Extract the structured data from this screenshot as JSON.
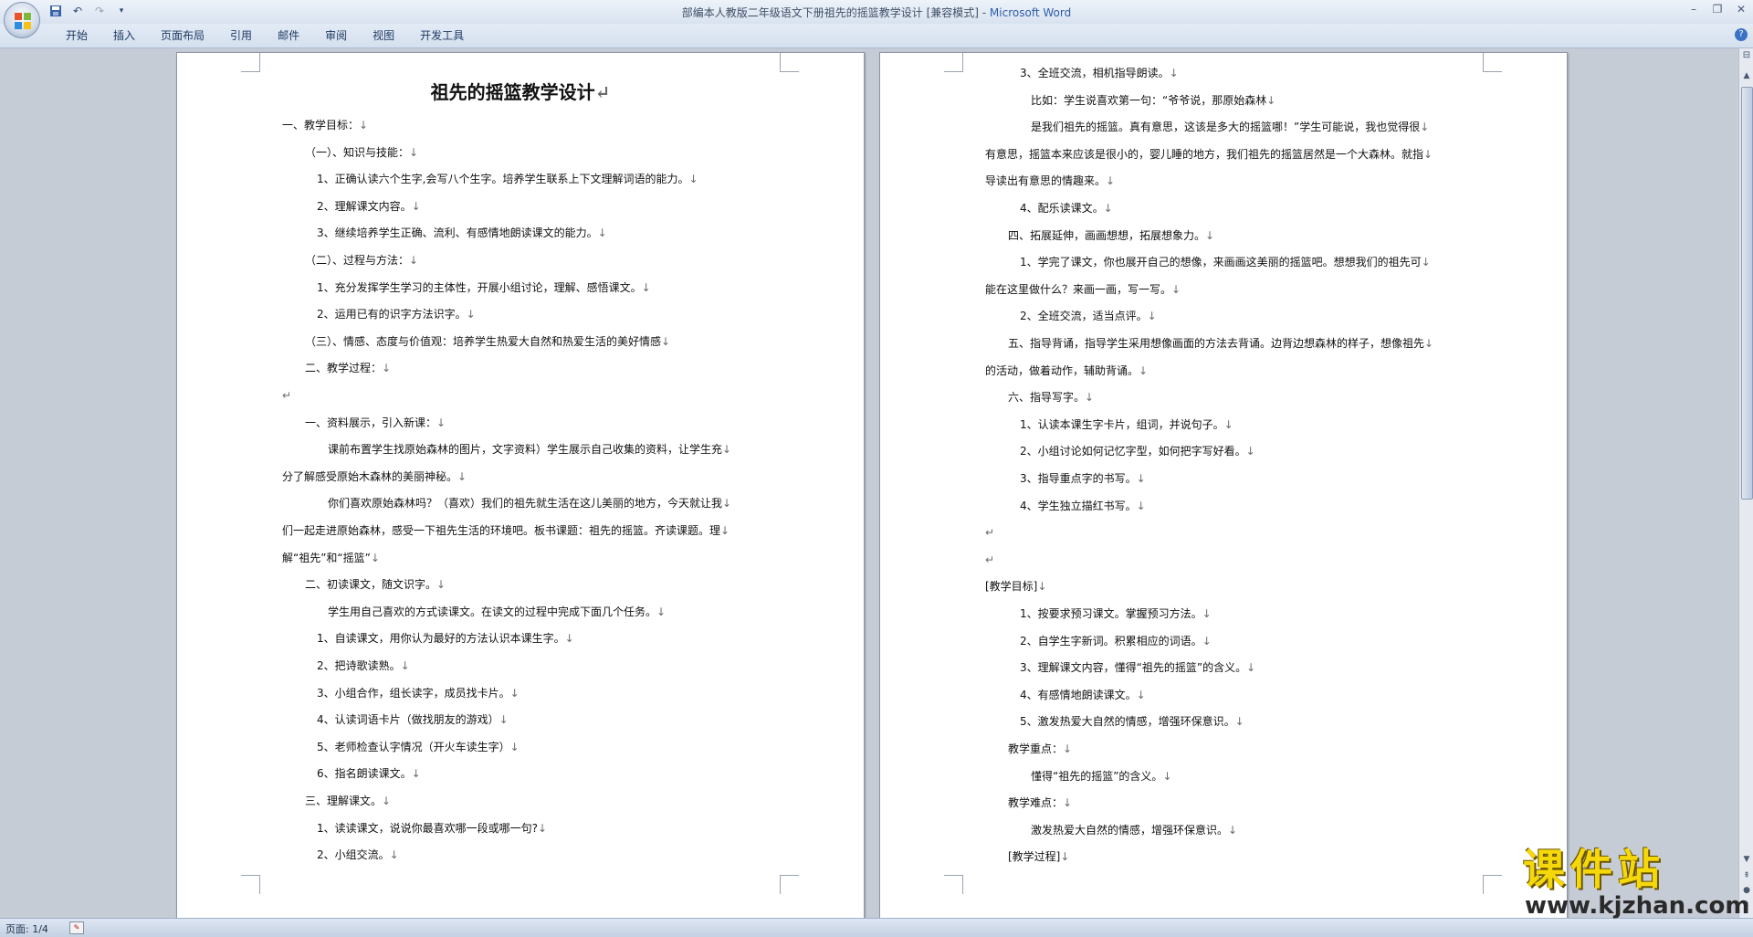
{
  "window": {
    "title": "部编本人教版二年级语文下册祖先的摇篮教学设计 [兼容模式] - ",
    "app_name": "Microsoft Word"
  },
  "ribbon": {
    "tabs": [
      "开始",
      "插入",
      "页面布局",
      "引用",
      "邮件",
      "审阅",
      "视图",
      "开发工具"
    ]
  },
  "status": {
    "page": "页面: 1/4"
  },
  "watermark": {
    "cn": "课件站",
    "url": "www.kjzhan.com"
  },
  "page1": {
    "title": "祖先的摇篮教学设计",
    "lines": [
      "一、教学目标：",
      "（一）、知识与技能：",
      "1、正确认读六个生字,会写八个生字。培养学生联系上下文理解词语的能力。",
      "2、理解课文内容。",
      "3、继续培养学生正确、流利、有感情地朗读课文的能力。",
      "（二）、过程与方法：",
      "1、充分发挥学生学习的主体性，开展小组讨论，理解、感悟课文。",
      "2、运用已有的识字方法识字。",
      "（三）、情感、态度与价值观：培养学生热爱大自然和热爱生活的美好情感",
      "二、教学过程：",
      "",
      "一、资料展示，引入新课：",
      "课前布置学生找原始森林的图片，文字资料）学生展示自己收集的资料，让学生充",
      "分了解感受原始木森林的美丽神秘。",
      "你们喜欢原始森林吗？（喜欢）我们的祖先就生活在这儿美丽的地方，今天就让我",
      "们一起走进原始森林，感受一下祖先生活的环境吧。板书课题：祖先的摇篮。齐读课题。理",
      "解“祖先”和“摇篮”",
      "二、初读课文，随文识字。",
      "学生用自己喜欢的方式读课文。在读文的过程中完成下面几个任务。",
      "1、自读课文，用你认为最好的方法认识本课生字。",
      "2、把诗歌读熟。",
      "3、小组合作，组长读字，成员找卡片。",
      "4、认读词语卡片（做找朋友的游戏）",
      "5、老师检查认字情况（开火车读生字）",
      "6、指名朗读课文。",
      "三、理解课文。",
      "1、读读课文，说说你最喜欢哪一段或哪一句?",
      "2、小组交流。"
    ]
  },
  "page2": {
    "lines": [
      "3、全班交流，相机指导朗读。",
      "比如：学生说喜欢第一句：“爷爷说，那原始森林",
      "是我们祖先的摇篮。真有意思，这该是多大的摇篮哪！”学生可能说，我也觉得很",
      "有意思，摇篮本来应该是很小的，婴儿睡的地方，我们祖先的摇篮居然是一个大森林。就指",
      "导读出有意思的情趣来。",
      "4、配乐读课文。",
      "四、拓展延伸，画画想想，拓展想象力。",
      "1、学完了课文，你也展开自己的想像，来画画这美丽的摇篮吧。想想我们的祖先可",
      "能在这里做什么？来画一画，写一写。",
      "2、全班交流，适当点评。",
      "五、指导背诵，指导学生采用想像画面的方法去背诵。边背边想森林的样子，想像祖先",
      "的活动，做着动作，辅助背诵。",
      "六、指导写字。",
      "1、认读本课生字卡片，组词，并说句子。",
      "2、小组讨论如何记忆字型，如何把字写好看。",
      "3、指导重点字的书写。",
      "4、学生独立描红书写。",
      "",
      "",
      "[教学目标]",
      "1、按要求预习课文。掌握预习方法。",
      "2、自学生字新词。积累相应的词语。",
      "3、理解课文内容，懂得“祖先的摇篮”的含义。",
      "4、有感情地朗读课文。",
      "5、激发热爱大自然的情感，增强环保意识。",
      "教学重点：",
      "懂得“祖先的摇篮”的含义。",
      "教学难点：",
      "激发热爱大自然的情感，增强环保意识。",
      "[教学过程]"
    ]
  }
}
